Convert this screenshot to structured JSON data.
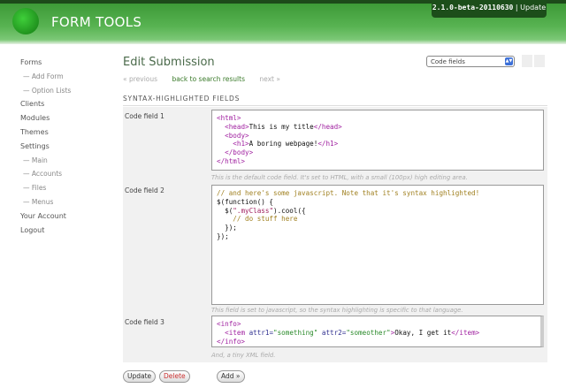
{
  "header": {
    "logo_text": "FORM TOOLS",
    "version": "2.1.0-beta-20110630",
    "separator": "|",
    "update_link": "Update"
  },
  "sidebar": {
    "items": [
      {
        "label": "Forms"
      },
      {
        "label": "— Add Form",
        "sub": true
      },
      {
        "label": "— Option Lists",
        "sub": true
      },
      {
        "label": "Clients"
      },
      {
        "label": "Modules"
      },
      {
        "label": "Themes"
      },
      {
        "label": "Settings"
      },
      {
        "label": "— Main",
        "sub": true
      },
      {
        "label": "— Accounts",
        "sub": true
      },
      {
        "label": "— Files",
        "sub": true
      },
      {
        "label": "— Menus",
        "sub": true
      },
      {
        "label": "Your Account"
      },
      {
        "label": "Logout"
      }
    ]
  },
  "main": {
    "title": "Edit Submission",
    "nav": {
      "previous": "« previous",
      "back": "back to search results",
      "next": "next »"
    },
    "view_select": "Code fields",
    "section_title": "SYNTAX-HIGHLIGHTED FIELDS",
    "fields": [
      {
        "label": "Code field 1",
        "hint": "This is the default code field. It's set to HTML, with a small (100px) high editing area.",
        "lines": [
          [
            [
              "t",
              "<html>"
            ]
          ],
          [
            [
              "p",
              "  "
            ],
            [
              "t",
              "<head>"
            ],
            [
              "p",
              "This is my title"
            ],
            [
              "t",
              "</head>"
            ]
          ],
          [
            [
              "p",
              "  "
            ],
            [
              "t",
              "<body>"
            ]
          ],
          [
            [
              "p",
              "    "
            ],
            [
              "t",
              "<h1>"
            ],
            [
              "p",
              "A boring webpage!"
            ],
            [
              "t",
              "</h1>"
            ]
          ],
          [
            [
              "p",
              "  "
            ],
            [
              "t",
              "</body>"
            ]
          ],
          [
            [
              "t",
              "</html>"
            ]
          ]
        ]
      },
      {
        "label": "Code field 2",
        "hint": "This field is set to javascript, so the syntax highlighting is specific to that language.",
        "lines": [
          [
            [
              "c",
              "// and here's some javascript. Note that it's syntax highlighted!"
            ]
          ],
          [
            [
              "p",
              "$(function() {"
            ]
          ],
          [
            [
              "p",
              "  $("
            ],
            [
              "s",
              "\".myClass\""
            ],
            [
              "p",
              ").cool({"
            ]
          ],
          [
            [
              "c",
              "    // do stuff here"
            ]
          ],
          [
            [
              "p",
              "  });"
            ]
          ],
          [
            [
              "p",
              "});"
            ]
          ]
        ]
      },
      {
        "label": "Code field 3",
        "hint": "And, a tiny XML field.",
        "lines": [
          [
            [
              "t",
              "<info>"
            ]
          ],
          [
            [
              "p",
              "  "
            ],
            [
              "t",
              "<item "
            ],
            [
              "a",
              "attr1="
            ],
            [
              "v",
              "\"something\""
            ],
            [
              "a",
              " attr2="
            ],
            [
              "v",
              "\"someother\""
            ],
            [
              "t",
              ">"
            ],
            [
              "p",
              "Okay, I get it"
            ],
            [
              "t",
              "</item>"
            ]
          ],
          [
            [
              "t",
              "</info>"
            ]
          ]
        ]
      }
    ],
    "buttons": {
      "update": "Update",
      "delete": "Delete",
      "add": "Add »"
    }
  }
}
